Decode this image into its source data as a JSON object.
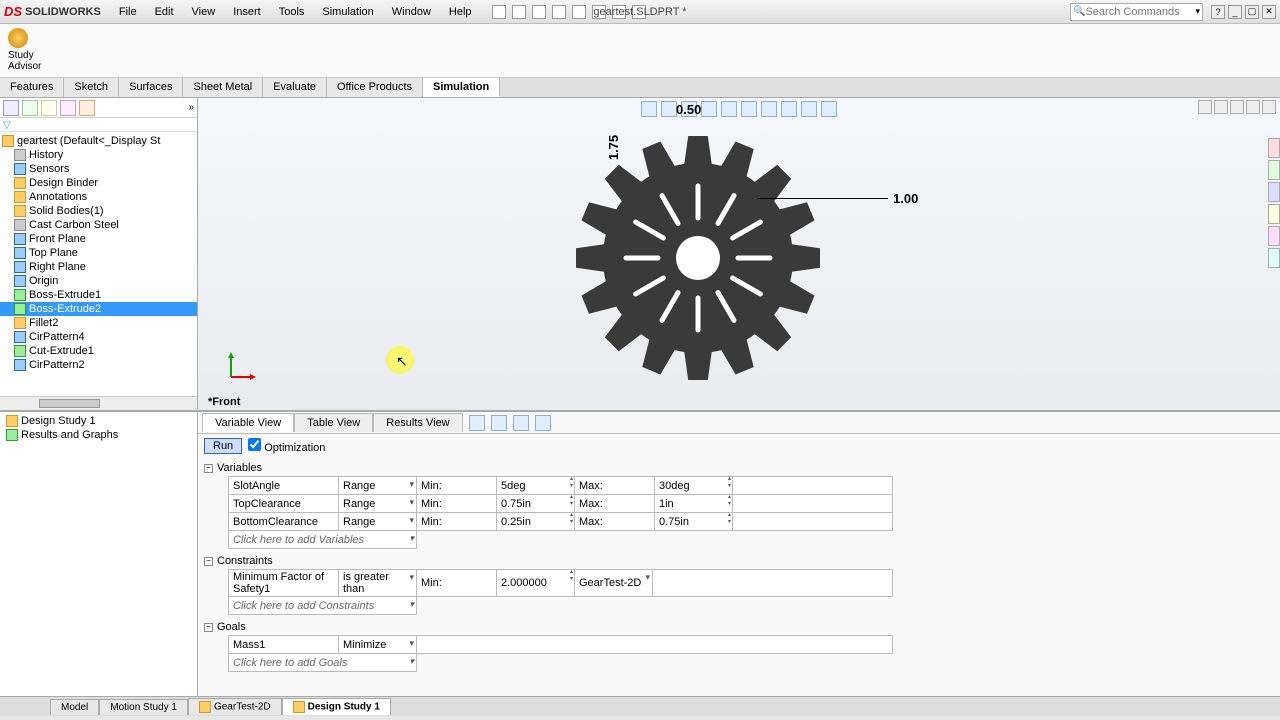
{
  "app": {
    "name": "SOLIDWORKS",
    "doc_title": "geartest.SLDPRT *",
    "search_placeholder": "Search Commands"
  },
  "menus": [
    "File",
    "Edit",
    "View",
    "Insert",
    "Tools",
    "Simulation",
    "Window",
    "Help"
  ],
  "advisor": {
    "line1": "Study",
    "line2": "Advisor"
  },
  "cmd_tabs": [
    "Features",
    "Sketch",
    "Surfaces",
    "Sheet Metal",
    "Evaluate",
    "Office Products",
    "Simulation"
  ],
  "cmd_active": 6,
  "feature_tree": {
    "root": "geartest  (Default<<Default>_Display St",
    "items": [
      {
        "label": "History",
        "ico": "gray"
      },
      {
        "label": "Sensors",
        "ico": "blue"
      },
      {
        "label": "Design Binder",
        "ico": ""
      },
      {
        "label": "Annotations",
        "ico": ""
      },
      {
        "label": "Solid Bodies(1)",
        "ico": ""
      },
      {
        "label": "Cast Carbon Steel",
        "ico": "gray"
      },
      {
        "label": "Front Plane",
        "ico": "blue"
      },
      {
        "label": "Top Plane",
        "ico": "blue"
      },
      {
        "label": "Right Plane",
        "ico": "blue"
      },
      {
        "label": "Origin",
        "ico": "blue"
      },
      {
        "label": "Boss-Extrude1",
        "ico": "green"
      },
      {
        "label": "Boss-Extrude2",
        "ico": "green",
        "selected": true
      },
      {
        "label": "Fillet2",
        "ico": ""
      },
      {
        "label": "CirPattern4",
        "ico": "blue"
      },
      {
        "label": "Cut-Extrude1",
        "ico": "green"
      },
      {
        "label": "CirPattern2",
        "ico": "blue"
      }
    ]
  },
  "viewport": {
    "dim_top": "0.50",
    "dim_left": "1.75",
    "dim_right": "1.00",
    "view_label": "*Front"
  },
  "study_tree": [
    {
      "label": "Design Study 1",
      "ico": ""
    },
    {
      "label": "Results and Graphs",
      "ico": "green"
    }
  ],
  "ds": {
    "tabs": [
      "Variable View",
      "Table View",
      "Results View"
    ],
    "tab_active": 0,
    "run_label": "Run",
    "opt_label": "Optimization",
    "sec_variables": "Variables",
    "sec_constraints": "Constraints",
    "sec_goals": "Goals",
    "vars": [
      {
        "name": "SlotAngle",
        "type": "Range",
        "minlbl": "Min:",
        "min": "5deg",
        "maxlbl": "Max:",
        "max": "30deg"
      },
      {
        "name": "TopClearance",
        "type": "Range",
        "minlbl": "Min:",
        "min": "0.75in",
        "maxlbl": "Max:",
        "max": "1in"
      },
      {
        "name": "BottomClearance",
        "type": "Range",
        "minlbl": "Min:",
        "min": "0.25in",
        "maxlbl": "Max:",
        "max": "0.75in"
      }
    ],
    "var_add": "Click here to add Variables",
    "cons": [
      {
        "name": "Minimum Factor of Safety1",
        "op": "is greater than",
        "minlbl": "Min:",
        "min": "2.000000",
        "study": "GearTest-2D"
      }
    ],
    "con_add": "Click here to add Constraints",
    "goals": [
      {
        "name": "Mass1",
        "type": "Minimize"
      }
    ],
    "goal_add": "Click here to add Goals"
  },
  "bottom_tabs": [
    "Model",
    "Motion Study 1",
    "GearTest-2D",
    "Design Study 1"
  ],
  "bottom_active": 3
}
